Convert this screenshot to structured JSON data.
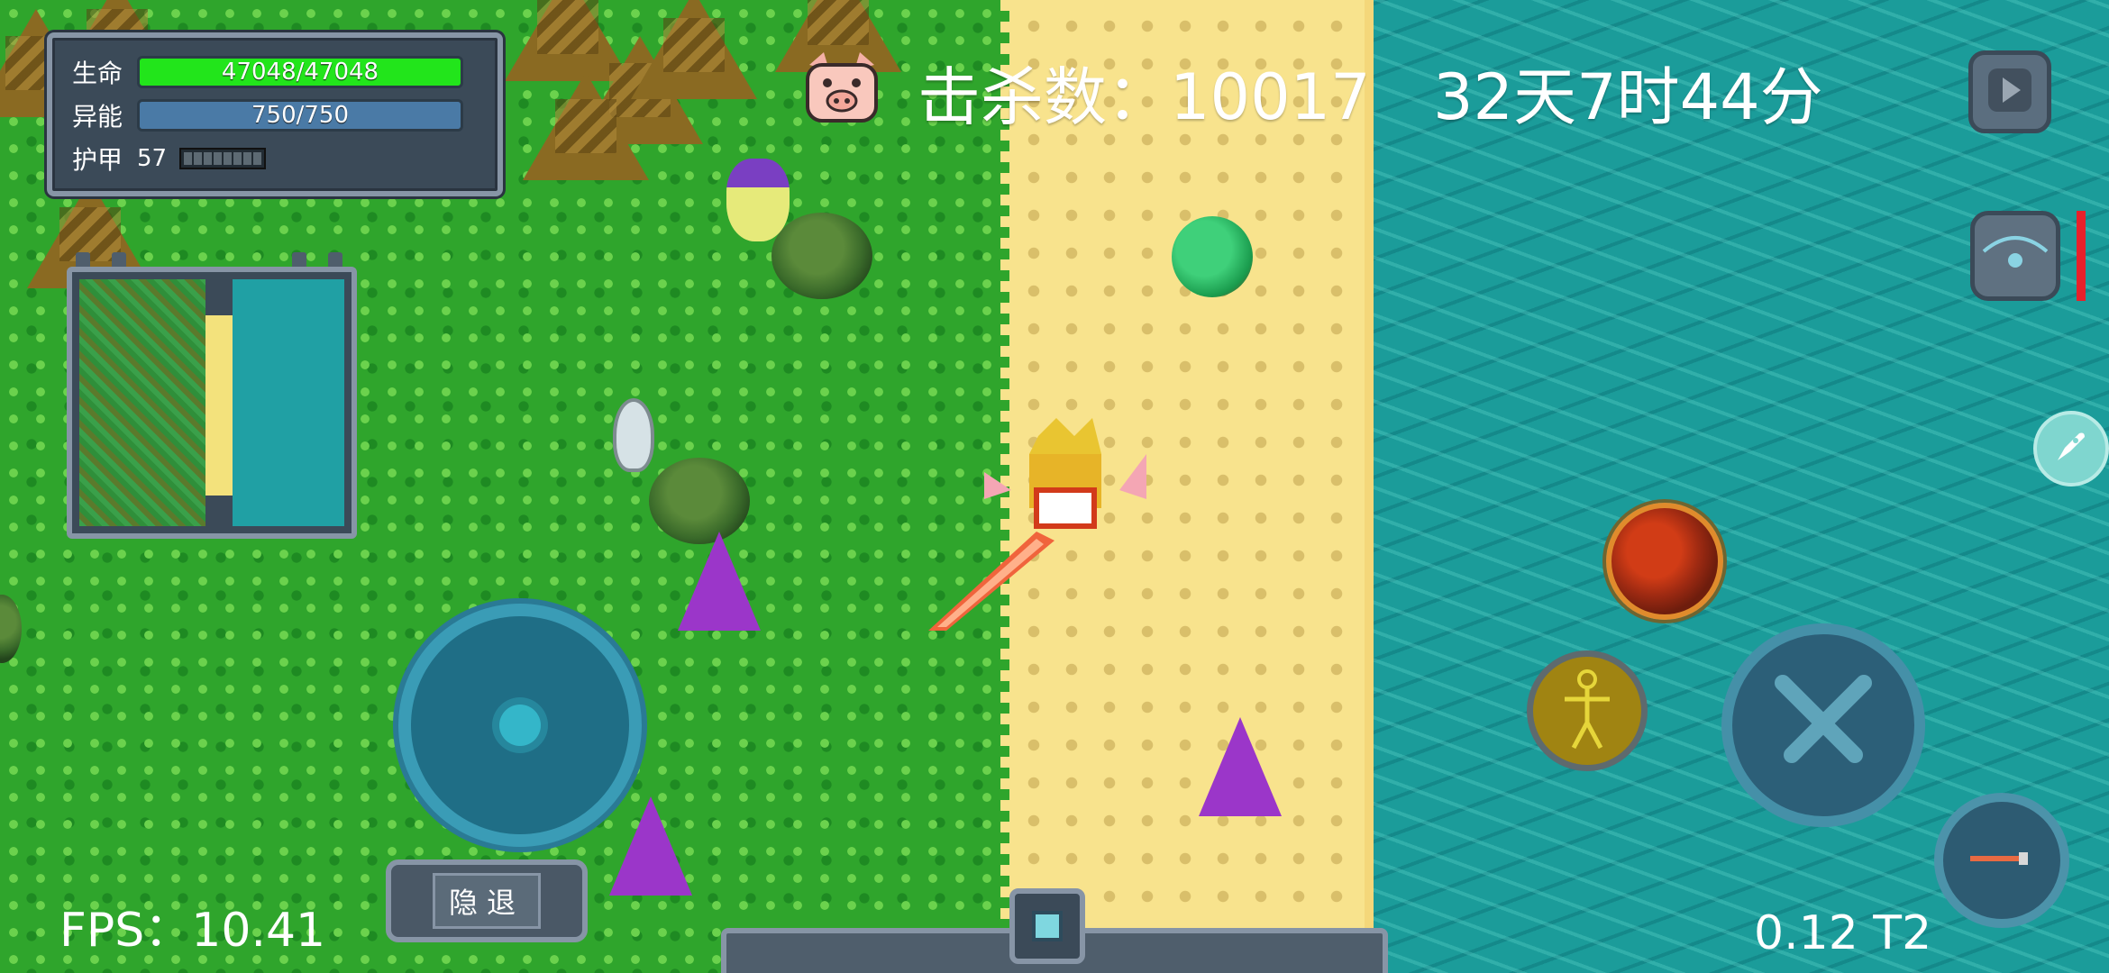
{
  "hud": {
    "hp": {
      "label": "生命",
      "text": "47048/47048",
      "fraction": 1.0,
      "color": "#22e51b"
    },
    "mp": {
      "label": "异能",
      "text": "750/750",
      "fraction": 1.0,
      "color": "#4a7aa6"
    },
    "armor": {
      "label": "护甲",
      "value": "57",
      "pips": 8
    }
  },
  "top": {
    "pig_icon": "pig-icon",
    "kills_text": "击杀数：10017",
    "time_text": "32天7时44分"
  },
  "controls": {
    "pause_icon": "pause-icon",
    "backpack_icon": "backpack-icon",
    "rocket_icon": "rocket-icon",
    "fire_skill_icon": "fire-orb-icon",
    "body_skill_icon": "body-skill-icon",
    "attack_icon": "crossed-swords-icon",
    "weapon_icon": "weapon-slot-icon",
    "retreat_label": "隐退",
    "joystick_icon": "joystick"
  },
  "footer": {
    "fps_text": "FPS：10.41",
    "version_text": "0.12 T2"
  },
  "colors": {
    "grass": "#2fa52c",
    "sand": "#f8e38d",
    "water": "#1b9c9a",
    "panel": "#3b4a58",
    "accent_red": "#e8202a"
  }
}
